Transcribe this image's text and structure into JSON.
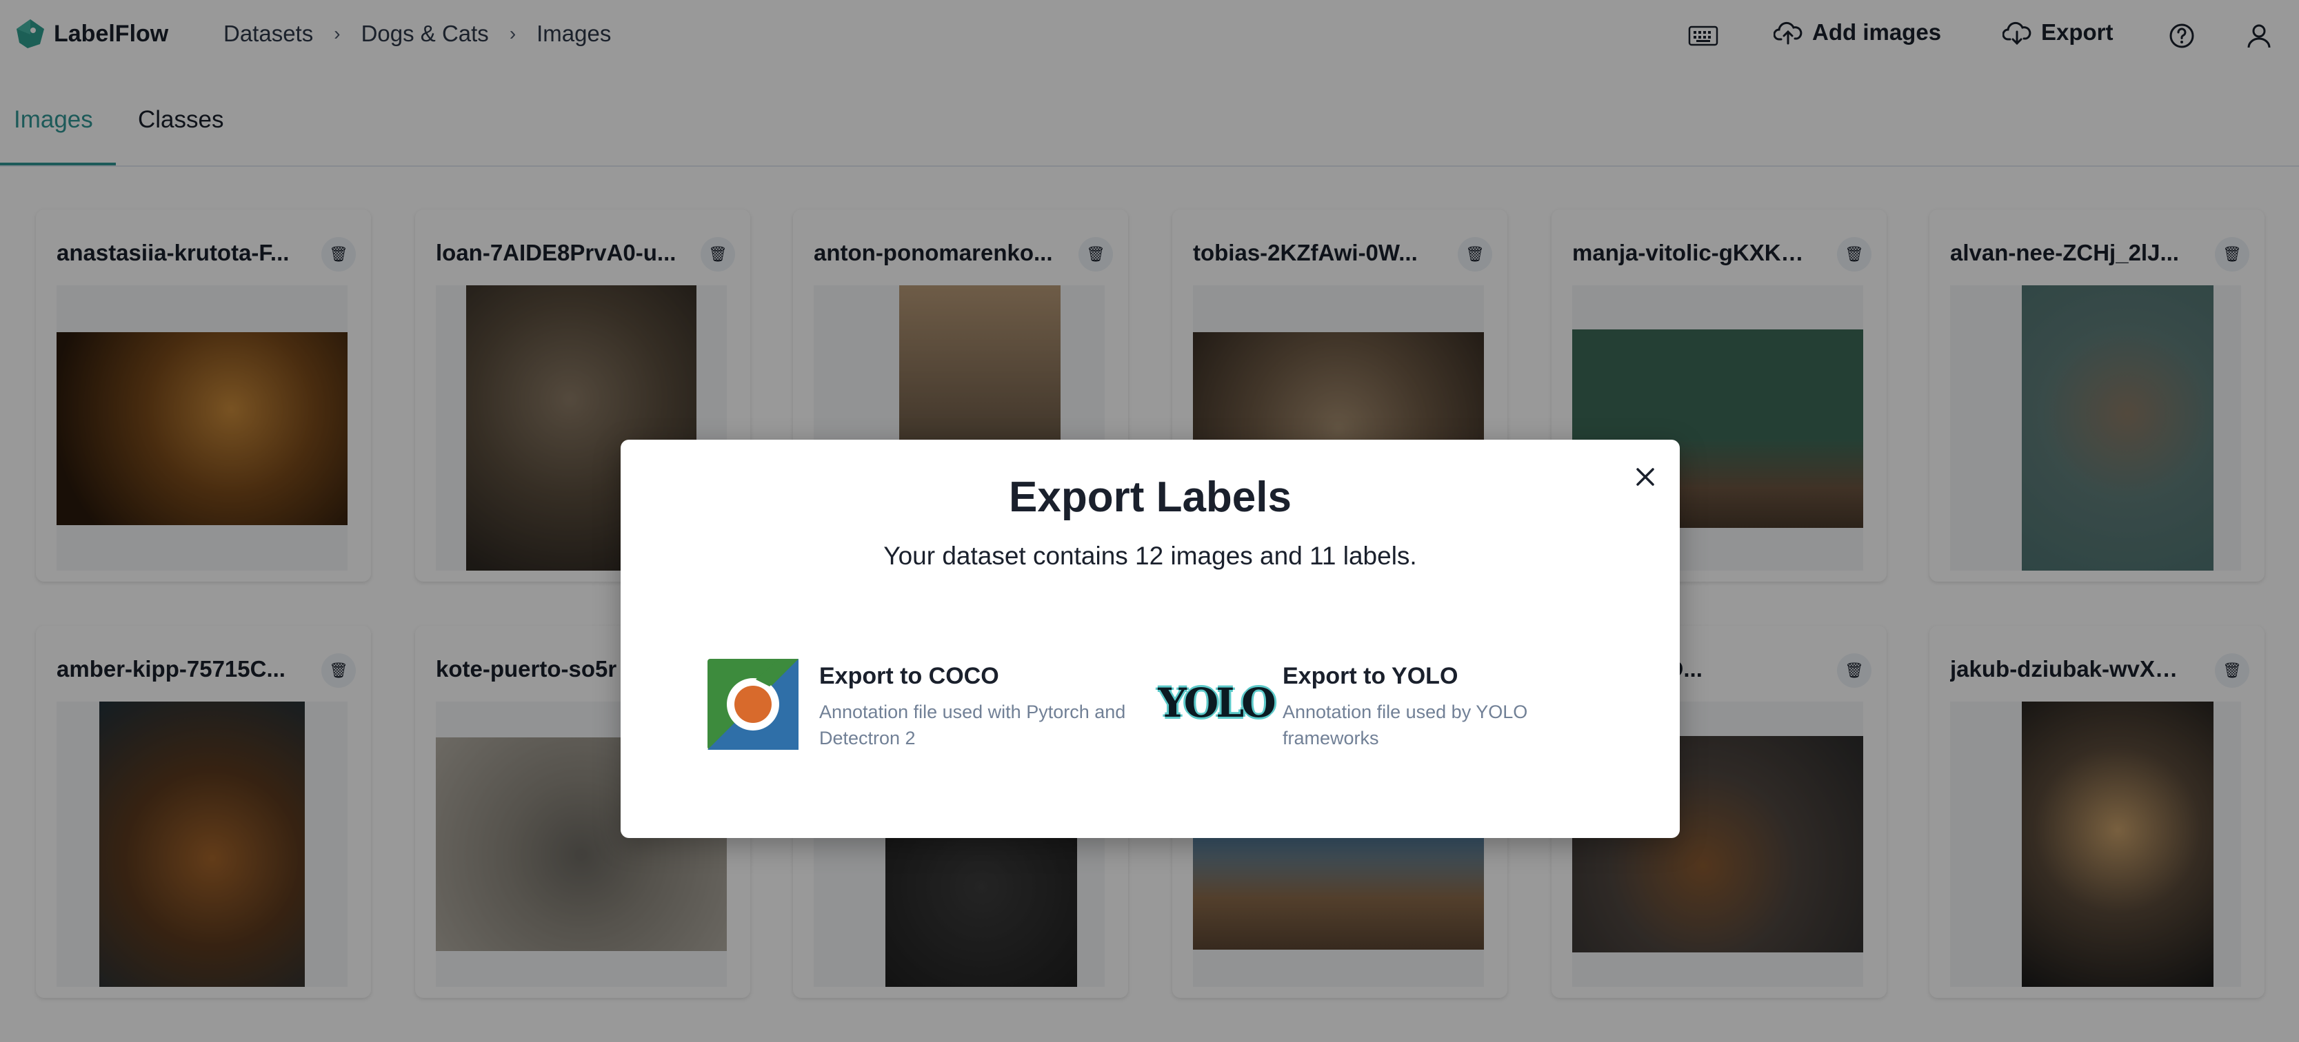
{
  "app": {
    "name": "LabelFlow"
  },
  "breadcrumbs": [
    "Datasets",
    "Dogs & Cats",
    "Images"
  ],
  "header": {
    "add_images": "Add images",
    "export": "Export"
  },
  "tabs": [
    "Images",
    "Classes"
  ],
  "images": [
    {
      "name": "anastasiia-krutota-F..."
    },
    {
      "name": "loan-7AIDE8PrvA0-u..."
    },
    {
      "name": "anton-ponomarenko..."
    },
    {
      "name": "tobias-2KZfAwi-0W..."
    },
    {
      "name": "manja-vitolic-gKXKB..."
    },
    {
      "name": "alvan-nee-ZCHj_2lJ..."
    },
    {
      "name": "amber-kipp-75715C..."
    },
    {
      "name": "kote-puerto-so5r"
    },
    {
      "name": ""
    },
    {
      "name": ""
    },
    {
      "name": "ov-F1srsD..."
    },
    {
      "name": "jakub-dziubak-wvXG..."
    }
  ],
  "modal": {
    "title": "Export Labels",
    "subtitle": "Your dataset contains 12 images and 11 labels.",
    "options": [
      {
        "title": "Export to COCO",
        "description": "Annotation file used with Pytorch and Detectron 2",
        "icon": "coco-logo"
      },
      {
        "title": "Export to YOLO",
        "description": "Annotation file used by YOLO frameworks",
        "icon": "yolo-logo",
        "logo_text": "YOLO"
      }
    ]
  },
  "colors": {
    "accent": "#319795",
    "overlay": "rgba(0,0,0,0.4)"
  }
}
